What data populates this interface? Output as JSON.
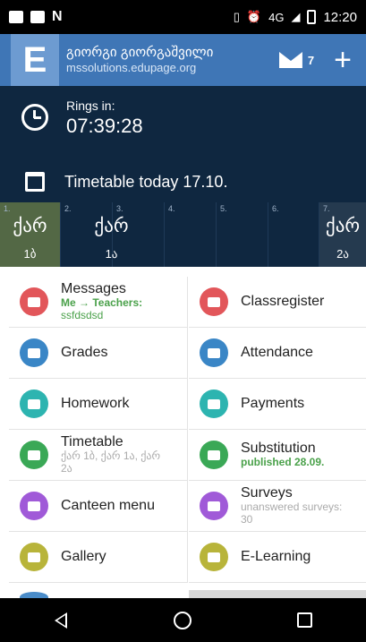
{
  "status_bar": {
    "network": "4G",
    "time": "12:20"
  },
  "app_bar": {
    "user_name": "გიორგი გიორგაშვილი",
    "domain": "mssolutions.edupage.org",
    "logo_letter": "E",
    "mail_count": "7",
    "add_label": "+"
  },
  "rings": {
    "label": "Rings in:",
    "time": "07:39:28"
  },
  "timetable_today": "Timetable today 17.10.",
  "periods": [
    {
      "num": "1.",
      "subject": "ქარ",
      "class": "1ბ"
    },
    {
      "num": "2.",
      "subject": "",
      "class": ""
    },
    {
      "num": "3.",
      "subject": "ქარ",
      "class": "1ა"
    },
    {
      "num": "4.",
      "subject": "",
      "class": ""
    },
    {
      "num": "5.",
      "subject": "",
      "class": ""
    },
    {
      "num": "6.",
      "subject": "",
      "class": ""
    },
    {
      "num": "7.",
      "subject": "ქარ",
      "class": "2ა"
    }
  ],
  "menu": {
    "messages": {
      "title": "Messages",
      "sub1": "Me → Teachers:",
      "sub2": "ssfdsdsd"
    },
    "classregister": {
      "title": "Classregister"
    },
    "grades": {
      "title": "Grades"
    },
    "attendance": {
      "title": "Attendance"
    },
    "homework": {
      "title": "Homework"
    },
    "payments": {
      "title": "Payments"
    },
    "timetable": {
      "title": "Timetable",
      "sub": "ქარ 1ბ, ქარ 1ა, ქარ 2ა"
    },
    "substitution": {
      "title": "Substitution",
      "sub": "published 28.09."
    },
    "canteen": {
      "title": "Canteen menu"
    },
    "surveys": {
      "title": "Surveys",
      "sub": "unanswered surveys: 30"
    },
    "gallery": {
      "title": "Gallery"
    },
    "elearning": {
      "title": "E-Learning"
    }
  },
  "colors": {
    "appbar": "#3f76b6",
    "dark_panel": "#0f2740",
    "red": "#e2565a",
    "blue": "#3a86c6",
    "teal": "#2db4b0",
    "green": "#3aa856",
    "purple": "#a05ad8",
    "olive": "#b8b43a"
  }
}
